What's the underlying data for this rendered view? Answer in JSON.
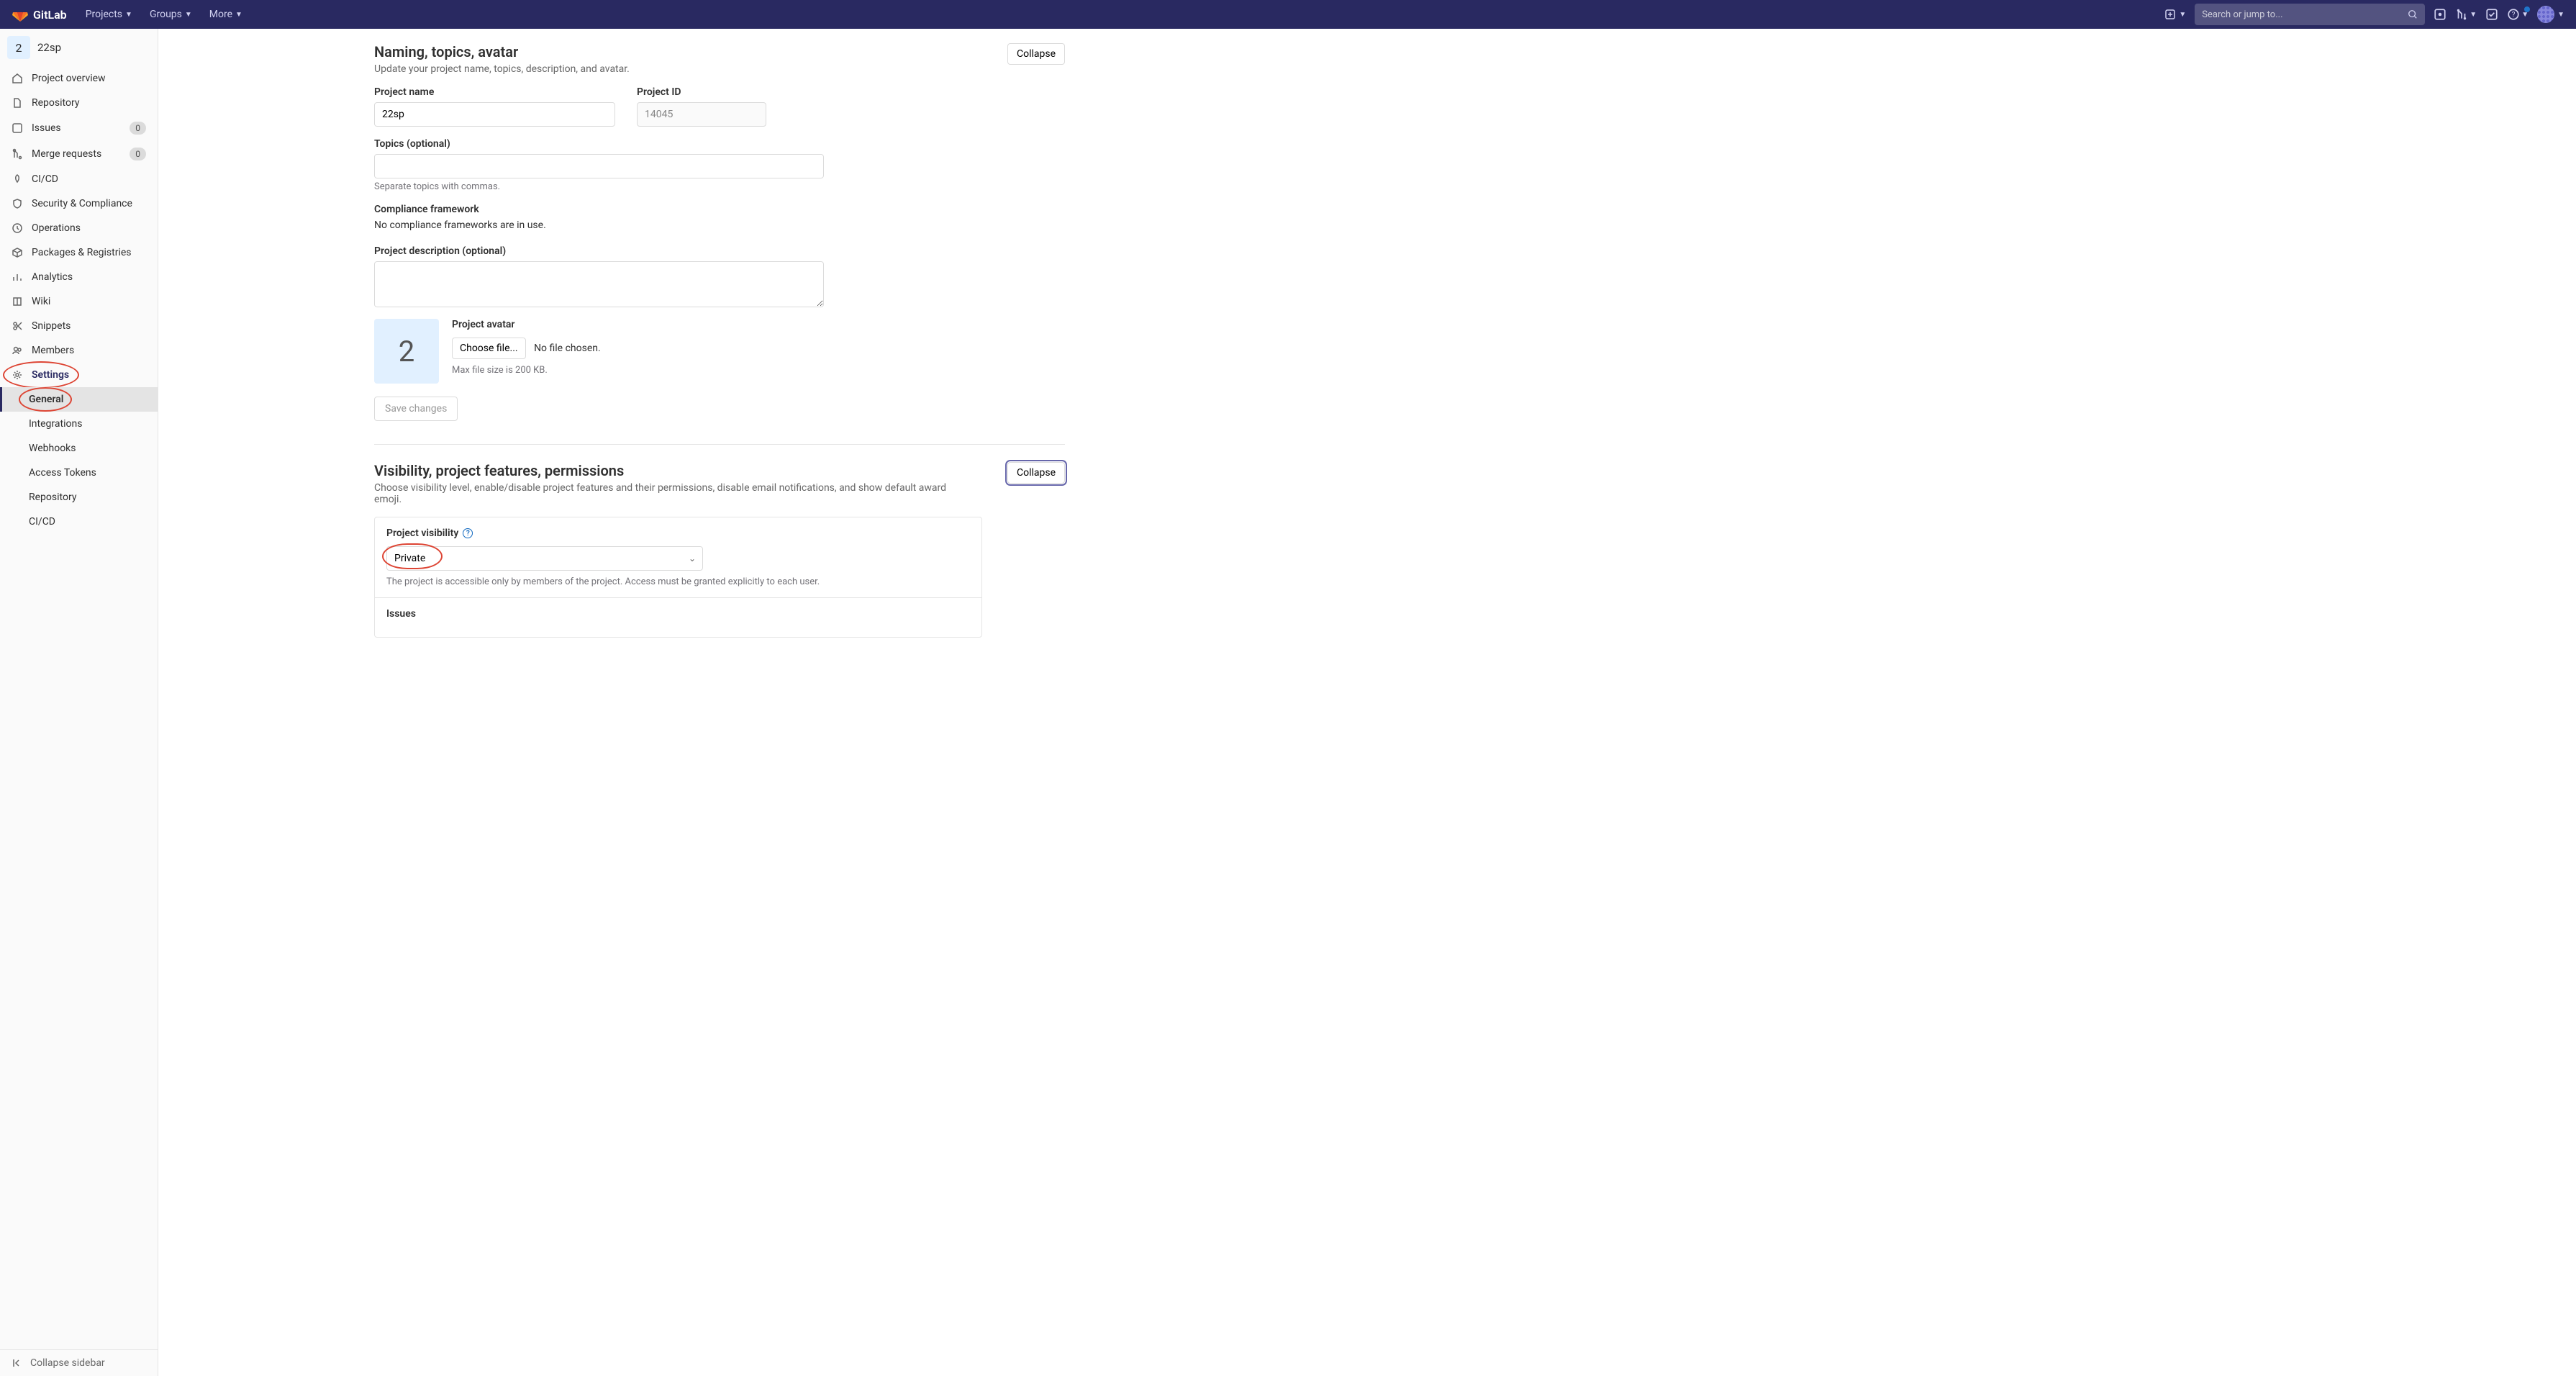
{
  "topnav": {
    "brand": "GitLab",
    "items": [
      "Projects",
      "Groups",
      "More"
    ],
    "search_placeholder": "Search or jump to..."
  },
  "sidebar": {
    "project_badge": "2",
    "project_name": "22sp",
    "issues_count": "0",
    "mr_count": "0",
    "items": {
      "overview": "Project overview",
      "repository": "Repository",
      "issues": "Issues",
      "merge_requests": "Merge requests",
      "cicd": "CI/CD",
      "security": "Security & Compliance",
      "operations": "Operations",
      "packages": "Packages & Registries",
      "analytics": "Analytics",
      "wiki": "Wiki",
      "snippets": "Snippets",
      "members": "Members",
      "settings": "Settings"
    },
    "settings_sub": {
      "general": "General",
      "integrations": "Integrations",
      "webhooks": "Webhooks",
      "access_tokens": "Access Tokens",
      "repository": "Repository",
      "cicd": "CI/CD"
    },
    "collapse": "Collapse sidebar"
  },
  "section1": {
    "title": "Naming, topics, avatar",
    "desc": "Update your project name, topics, description, and avatar.",
    "collapse": "Collapse",
    "project_name_label": "Project name",
    "project_name_value": "22sp",
    "project_id_label": "Project ID",
    "project_id_value": "14045",
    "topics_label": "Topics (optional)",
    "topics_help": "Separate topics with commas.",
    "compliance_label": "Compliance framework",
    "compliance_text": "No compliance frameworks are in use.",
    "desc_label": "Project description (optional)",
    "avatar_label": "Project avatar",
    "avatar_badge": "2",
    "choose_file": "Choose file...",
    "no_file": "No file chosen.",
    "max_size": "Max file size is 200 KB.",
    "save": "Save changes"
  },
  "section2": {
    "title": "Visibility, project features, permissions",
    "desc": "Choose visibility level, enable/disable project features and their permissions, disable email notifications, and show default award emoji.",
    "collapse": "Collapse",
    "visibility_label": "Project visibility",
    "visibility_value": "Private",
    "visibility_help": "The project is accessible only by members of the project. Access must be granted explicitly to each user.",
    "issues_label": "Issues"
  }
}
